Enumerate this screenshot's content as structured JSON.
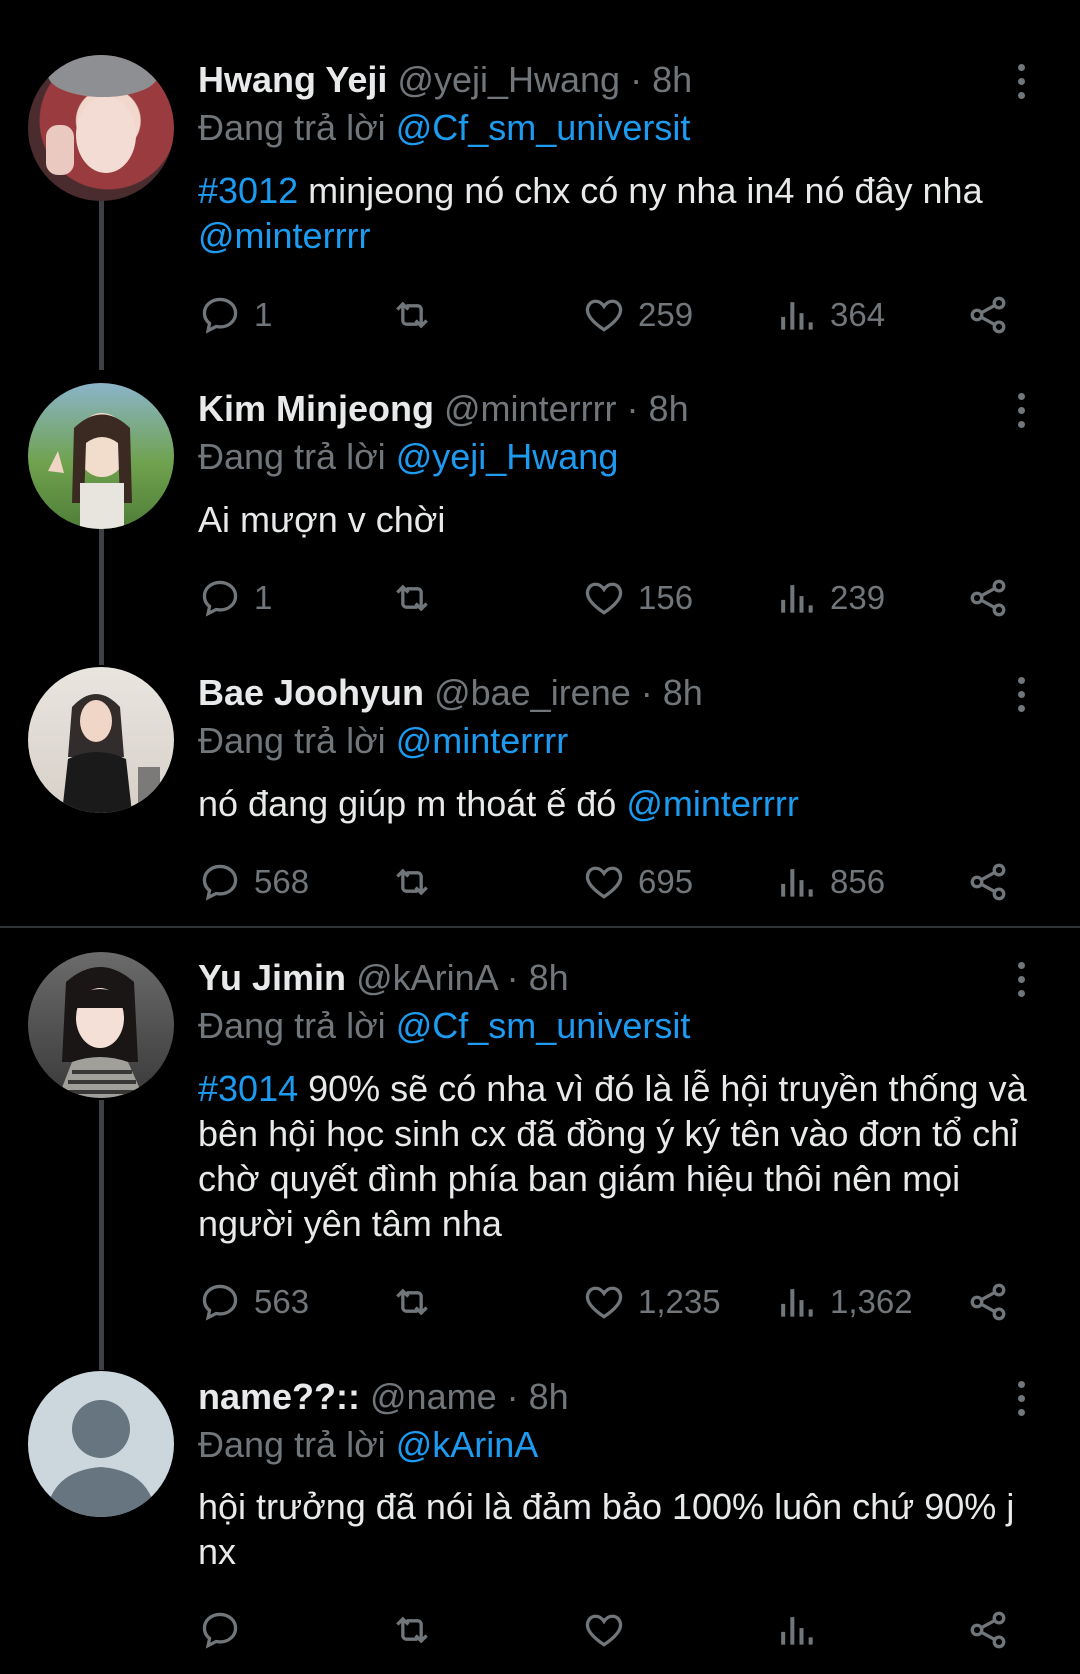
{
  "tweets": [
    {
      "name": "Hwang Yeji",
      "handle": "@yeji_Hwang",
      "time": "8h",
      "reply_label": "Đang trả lời",
      "reply_to": "@Cf_sm_universit",
      "tag": "#3012",
      "text": "minjeong nó chx có ny nha in4 nó đây nha",
      "mention": "@minterrrr",
      "replies": "1",
      "retweets": "",
      "likes": "259",
      "views": "364"
    },
    {
      "name": "Kim Minjeong",
      "handle": "@minterrrr",
      "time": "8h",
      "reply_label": "Đang trả lời",
      "reply_to": "@yeji_Hwang",
      "text": "Ai mượn v chời",
      "replies": "1",
      "retweets": "",
      "likes": "156",
      "views": "239"
    },
    {
      "name": "Bae Joohyun",
      "handle": "@bae_irene",
      "time": "8h",
      "reply_label": "Đang trả lời",
      "reply_to": "@minterrrr",
      "text": "nó đang giúp m thoát ế đó",
      "mention": "@minterrrr",
      "replies": "568",
      "retweets": "",
      "likes": "695",
      "views": "856"
    },
    {
      "name": "Yu Jimin",
      "handle": "@kArinA",
      "time": "8h",
      "reply_label": "Đang trả lời",
      "reply_to": "@Cf_sm_universit",
      "tag": "#3014",
      "text": "90% sẽ có nha vì đó là lễ hội truyền thống và bên hội học sinh cx đã đồng ý ký tên vào đơn tổ chỉ chờ quyết đình phía ban giám hiệu thôi nên mọi người yên tâm nha",
      "replies": "563",
      "retweets": "",
      "likes": "1,235",
      "views": "1,362"
    },
    {
      "name": "name??::",
      "handle": "@name",
      "time": "8h",
      "reply_label": "Đang trả lời",
      "reply_to": "@kArinA",
      "text": "hội trưởng đã nói là đảm bảo 100% luôn chứ 90% j nx",
      "replies": "",
      "retweets": "",
      "likes": "",
      "views": ""
    }
  ],
  "separator": " · ",
  "icons": {
    "reply": "reply-icon",
    "retweet": "retweet-icon",
    "like": "heart-icon",
    "views": "views-icon",
    "share": "share-icon",
    "more": "more-icon"
  },
  "colors": {
    "background": "#000000",
    "text": "#e7e9ea",
    "muted": "#71767b",
    "link": "#1d9bf0"
  }
}
